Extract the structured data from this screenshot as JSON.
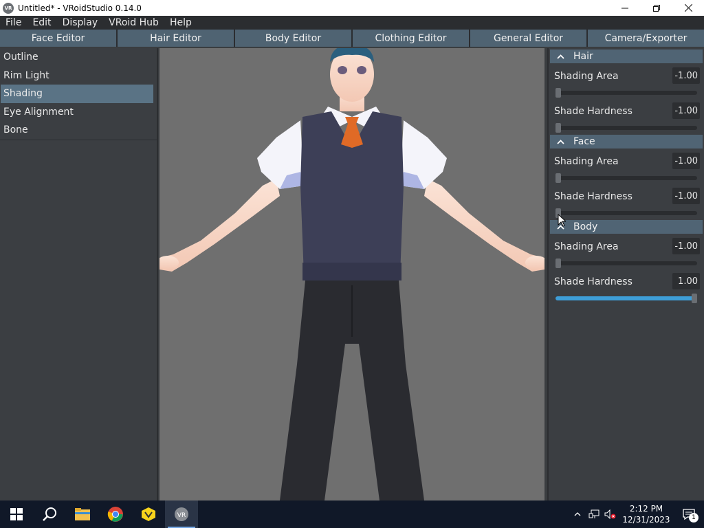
{
  "window": {
    "title": "Untitled* - VRoidStudio 0.14.0",
    "logo_text": "VR"
  },
  "menu": [
    "File",
    "Edit",
    "Display",
    "VRoid Hub",
    "Help"
  ],
  "tabs": [
    "Face Editor",
    "Hair Editor",
    "Body Editor",
    "Clothing Editor",
    "General Editor",
    "Camera/Exporter"
  ],
  "left_panel": {
    "items": [
      "Outline",
      "Rim Light",
      "Shading",
      "Eye Alignment",
      "Bone"
    ],
    "selected": "Shading"
  },
  "right_panel": {
    "sections": [
      {
        "title": "Hair",
        "rows": [
          {
            "label": "Shading Area",
            "value": "-1.00",
            "level": 0.0
          },
          {
            "label": "Shade Hardness",
            "value": "-1.00",
            "level": 0.0
          }
        ]
      },
      {
        "title": "Face",
        "rows": [
          {
            "label": "Shading Area",
            "value": "-1.00",
            "level": 0.0
          },
          {
            "label": "Shade Hardness",
            "value": "-1.00",
            "level": 0.0
          }
        ]
      },
      {
        "title": "Body",
        "rows": [
          {
            "label": "Shading Area",
            "value": "-1.00",
            "level": 0.0
          },
          {
            "label": "Shade Hardness",
            "value": "1.00",
            "level": 1.0
          }
        ]
      }
    ]
  },
  "taskbar": {
    "time": "2:12 PM",
    "date": "12/31/2023",
    "notification_count": "1",
    "apps": [
      "start-icon",
      "search-icon",
      "file-explorer-icon",
      "chrome-icon",
      "vroid-hub-icon",
      "vroid-studio-icon"
    ]
  },
  "colors": {
    "accent": "#3e9ed8",
    "tab_bg": "#4f6372",
    "viewport_bg": "#6f6f6f"
  }
}
